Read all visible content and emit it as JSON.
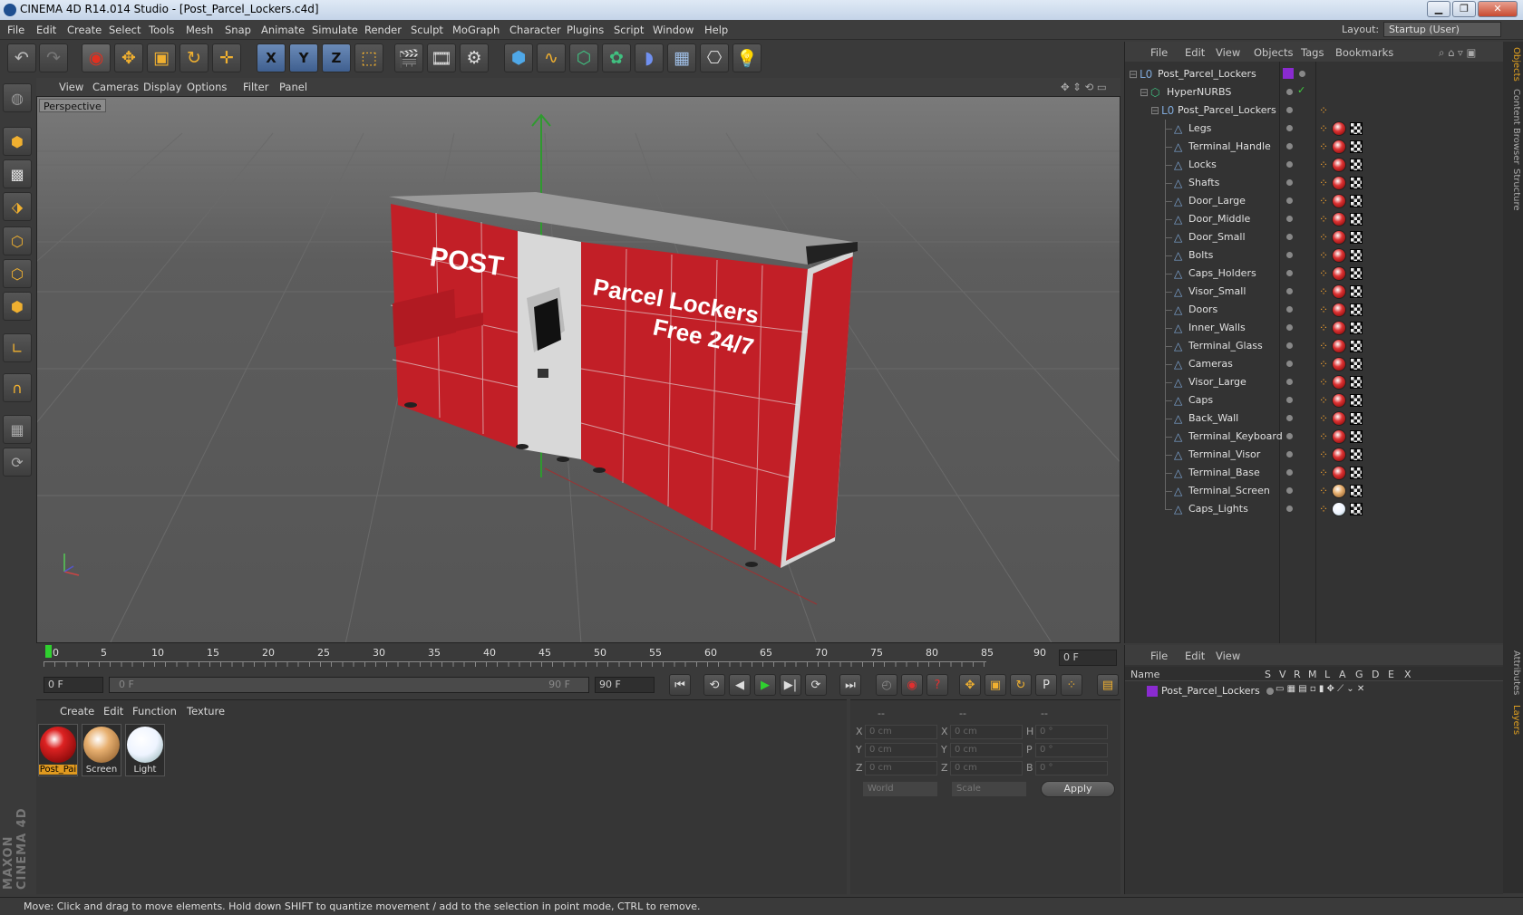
{
  "window": {
    "title": "CINEMA 4D R14.014 Studio - [Post_Parcel_Lockers.c4d]",
    "minimize": "▁",
    "maximize": "❐",
    "close": "✕"
  },
  "menubar": [
    "File",
    "Edit",
    "Create",
    "Select",
    "Tools",
    "Mesh",
    "Snap",
    "Animate",
    "Simulate",
    "Render",
    "Sculpt",
    "MoGraph",
    "Character",
    "Plugins",
    "Script",
    "Window",
    "Help"
  ],
  "layout": {
    "label": "Layout:",
    "value": "Startup (User)"
  },
  "toolbar_icons": [
    "undo-icon",
    "redo-icon",
    "live-selection-icon",
    "move-icon",
    "scale-icon",
    "rotate-icon",
    "add-icon",
    "x-axis-icon",
    "y-axis-icon",
    "z-axis-icon",
    "world-coords-icon",
    "render-view-icon",
    "render-picture-viewer-icon",
    "render-settings-icon",
    "cube-icon",
    "spline-icon",
    "nurbs-icon",
    "array-icon",
    "deformer-icon",
    "floor-icon",
    "camera-icon",
    "light-icon"
  ],
  "axes": {
    "x": "X",
    "y": "Y",
    "z": "Z"
  },
  "viewport": {
    "menu": [
      "View",
      "Cameras",
      "Display",
      "Options",
      "Filter",
      "Panel"
    ],
    "label": "Perspective",
    "scene_text": {
      "post": "POST",
      "title1": "Parcel Lockers",
      "title2": "Free 24/7"
    }
  },
  "timeline": {
    "ticks": [
      "0",
      "5",
      "10",
      "15",
      "20",
      "25",
      "30",
      "35",
      "40",
      "45",
      "50",
      "55",
      "60",
      "65",
      "70",
      "75",
      "80",
      "85",
      "90"
    ],
    "current_frame": "0 F"
  },
  "transport": {
    "start": "0 F",
    "slider_left": "0 F",
    "slider_right": "90 F",
    "end": "90 F"
  },
  "material_manager": {
    "menu": [
      "Create",
      "Edit",
      "Function",
      "Texture"
    ],
    "materials": [
      {
        "name": "Post_Pai",
        "color": "#c8202a",
        "selected": true
      },
      {
        "name": "Screen",
        "color": "#e8b070",
        "selected": false
      },
      {
        "name": "Light",
        "color": "#f4f8ff",
        "selected": false
      }
    ]
  },
  "coordinates": {
    "headers": [
      "--",
      "--",
      "--"
    ],
    "rows": [
      {
        "a": "X",
        "av": "0 cm",
        "b": "X",
        "bv": "0 cm",
        "c": "H",
        "cv": "0 °"
      },
      {
        "a": "Y",
        "av": "0 cm",
        "b": "Y",
        "bv": "0 cm",
        "c": "P",
        "cv": "0 °"
      },
      {
        "a": "Z",
        "av": "0 cm",
        "b": "Z",
        "bv": "0 cm",
        "c": "B",
        "cv": "0 °"
      }
    ],
    "mode": "World",
    "type": "Scale",
    "apply": "Apply"
  },
  "object_manager": {
    "menu": [
      "File",
      "Edit",
      "View",
      "Objects",
      "Tags",
      "Bookmarks"
    ],
    "root": "Post_Parcel_Lockers",
    "hypernurbs": "HyperNURBS",
    "group": "Post_Parcel_Lockers",
    "children": [
      "Legs",
      "Terminal_Handle",
      "Locks",
      "Shafts",
      "Door_Large",
      "Door_Middle",
      "Door_Small",
      "Bolts",
      "Caps_Holders",
      "Visor_Small",
      "Doors",
      "Inner_Walls",
      "Terminal_Glass",
      "Cameras",
      "Visor_Large",
      "Caps",
      "Back_Wall",
      "Terminal_Keyboard",
      "Terminal_Visor",
      "Terminal_Base",
      "Terminal_Screen",
      "Caps_Lights"
    ]
  },
  "layer_manager": {
    "menu": [
      "File",
      "Edit",
      "View"
    ],
    "columns": [
      "Name",
      "S",
      "V",
      "R",
      "M",
      "L",
      "A",
      "G",
      "D",
      "E",
      "X"
    ],
    "layer": "Post_Parcel_Lockers",
    "layer_color": "#8a2bd0"
  },
  "right_tabs": [
    "Objects",
    "Content Browser",
    "Structure",
    "Attributes",
    "Layers"
  ],
  "status": "Move: Click and drag to move elements. Hold down SHIFT to quantize movement / add to the selection in point mode, CTRL to remove.",
  "branding": "MAXON CINEMA 4D"
}
